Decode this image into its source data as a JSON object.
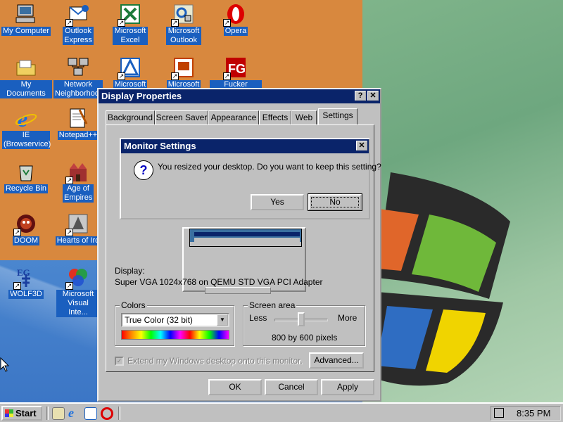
{
  "desktop": {
    "icons": [
      {
        "label": "My Computer",
        "glyph": "computer-icon"
      },
      {
        "label": "Outlook Express",
        "glyph": "outlook-express-icon"
      },
      {
        "label": "Microsoft Excel",
        "glyph": "excel-icon"
      },
      {
        "label": "Microsoft Outlook",
        "glyph": "outlook-icon"
      },
      {
        "label": "Opera",
        "glyph": "opera-icon"
      },
      {
        "label": "My Documents",
        "glyph": "folder-icon"
      },
      {
        "label": "Network Neighborhood",
        "glyph": "network-icon"
      },
      {
        "label": "Microsoft",
        "glyph": "access-icon"
      },
      {
        "label": "Microsoft",
        "glyph": "powerpoint-icon"
      },
      {
        "label": "Fucker Google",
        "glyph": "fg-icon"
      },
      {
        "label": "IE (Browservice)",
        "glyph": "ie-icon"
      },
      {
        "label": "Notepad++",
        "glyph": "notepad-icon"
      },
      {
        "label": "Recycle Bin",
        "glyph": "recycle-bin-icon"
      },
      {
        "label": "Age of Empires",
        "glyph": "age-of-empires-icon"
      },
      {
        "label": "DOOM",
        "glyph": "doom-icon"
      },
      {
        "label": "Hearts of Iro",
        "glyph": "hearts-of-iron-icon"
      },
      {
        "label": "WOLF3D",
        "glyph": "wolf3d-icon"
      },
      {
        "label": "Microsoft Visual Inte...",
        "glyph": "visual-interdev-icon"
      }
    ]
  },
  "window": {
    "title": "Display Properties",
    "help_btn": "?",
    "close_btn": "✕",
    "tabs": [
      "Background",
      "Screen Saver",
      "Appearance",
      "Effects",
      "Web",
      "Settings"
    ],
    "active_tab": "Settings",
    "display_label": "Display:",
    "display_value": "Super VGA 1024x768 on QEMU STD VGA PCI Adapter",
    "colors": {
      "title": "Colors",
      "selected": "True Color (32 bit)"
    },
    "screen_area": {
      "title": "Screen area",
      "less": "Less",
      "more": "More",
      "value": "800 by 600 pixels",
      "level": 0.5
    },
    "extend_label": "Extend my Windows desktop onto this monitor.",
    "advanced_btn": "Advanced...",
    "ok_btn": "OK",
    "cancel_btn": "Cancel",
    "apply_btn": "Apply"
  },
  "dialog": {
    "title": "Monitor Settings",
    "close_btn": "✕",
    "icon": "question-icon",
    "message": "You resized your desktop.  Do you want to keep this setting?",
    "yes_btn": "Yes",
    "no_btn": "No"
  },
  "taskbar": {
    "start_label": "Start",
    "clock": "8:35 PM"
  },
  "colors": {
    "titlebar": "#0a246a",
    "face": "#c0c0c0"
  }
}
